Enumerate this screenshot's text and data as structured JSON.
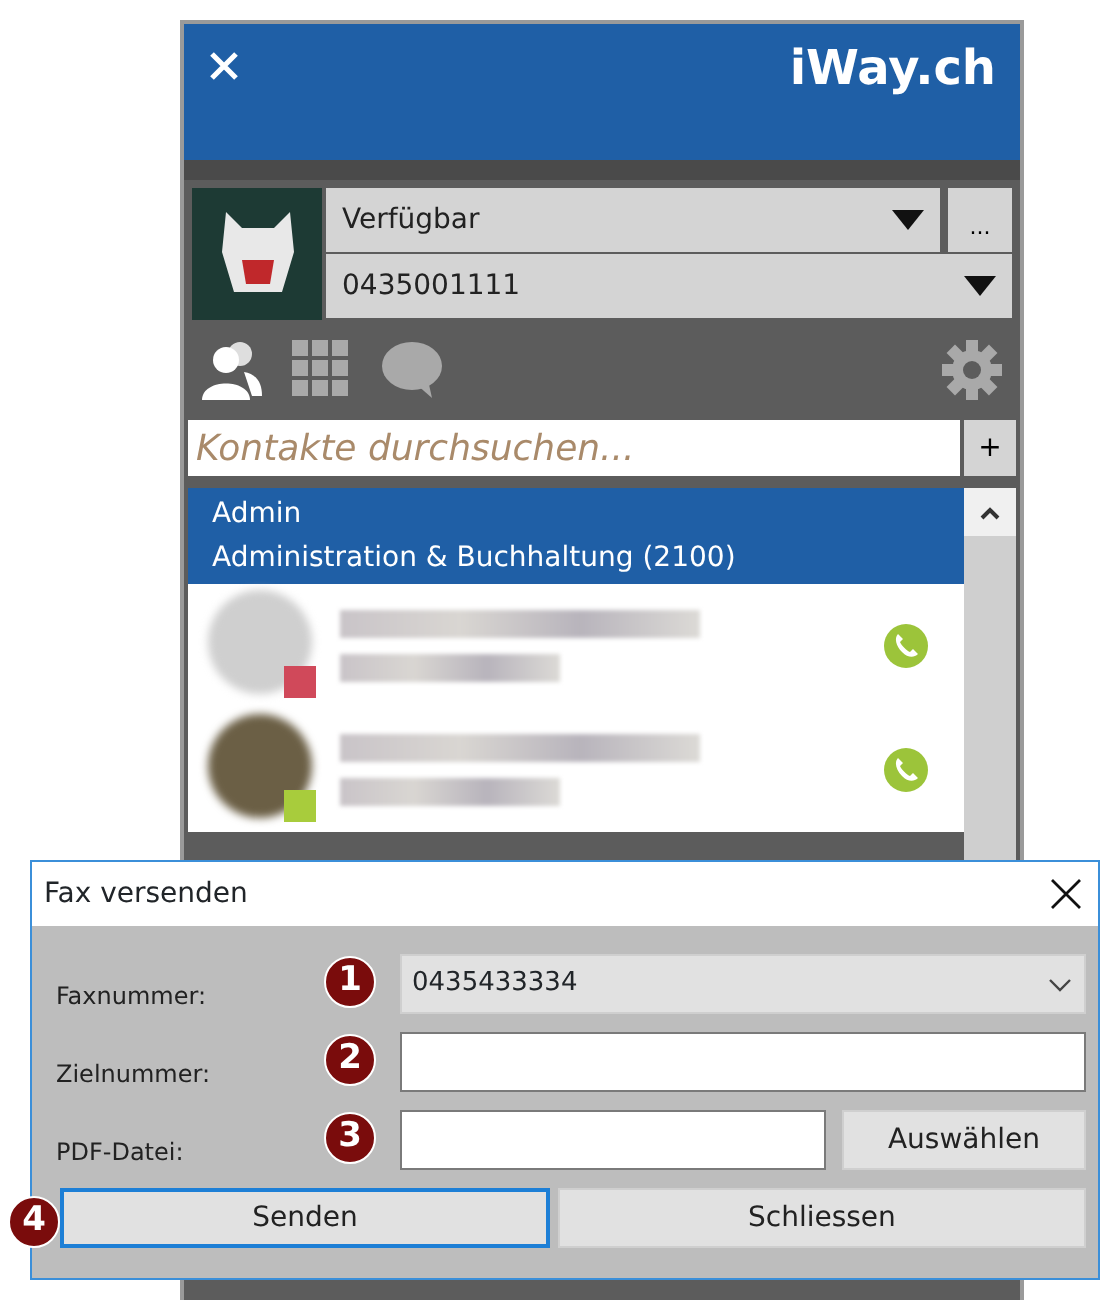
{
  "app": {
    "logo": "iWay.ch",
    "status": "Verfügbar",
    "more": "...",
    "number": "0435001111",
    "tabs": [
      {
        "kind": "contacts",
        "selected": true
      },
      {
        "kind": "dialpad",
        "selected": false
      },
      {
        "kind": "chat",
        "selected": false
      }
    ],
    "search": {
      "placeholder": "Kontakte durchsuchen..."
    },
    "add": "+",
    "group": {
      "title": "Admin",
      "subtitle": "Administration & Buchhaltung (2100)"
    },
    "contacts": [
      {
        "color": "#d0495a"
      },
      {
        "color": "#a8cc3c"
      }
    ]
  },
  "dialog": {
    "title": "Fax versenden",
    "fields": [
      {
        "kind": "select",
        "label": "Faxnummer:",
        "value": "0435433334",
        "marker": "1"
      },
      {
        "kind": "input",
        "label": "Zielnummer:",
        "marker": "2"
      },
      {
        "kind": "file",
        "label": "PDF-Datei:",
        "marker": "3",
        "button": "Auswählen"
      }
    ],
    "buttons": [
      {
        "label": "Senden",
        "focused": true,
        "marker": "4"
      },
      {
        "label": "Schliessen",
        "focused": false
      }
    ]
  }
}
